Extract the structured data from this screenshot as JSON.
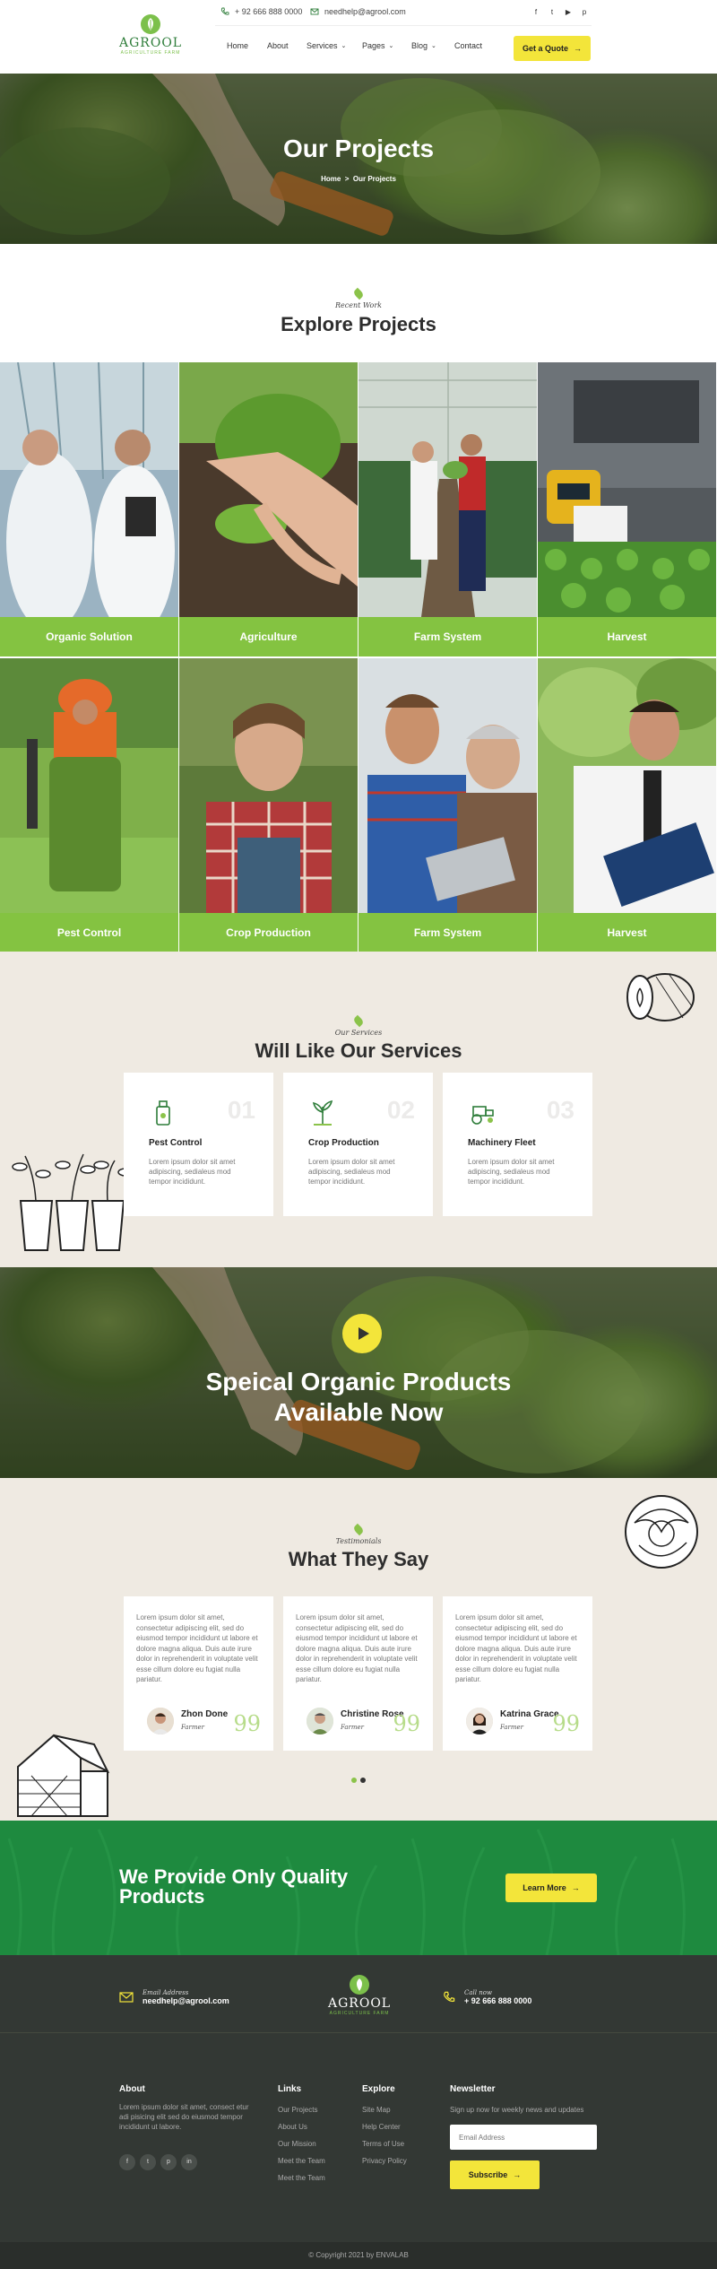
{
  "topbar": {
    "phone": "+ 92 666 888 0000",
    "email": "needhelp@agrool.com",
    "socials": [
      "facebook-icon",
      "twitter-icon",
      "youtube-icon",
      "pinterest-icon"
    ]
  },
  "brand": {
    "name": "AGROOL",
    "tagline": "AGRICULTURE FARM"
  },
  "nav": {
    "items": [
      {
        "label": "Home",
        "dropdown": false
      },
      {
        "label": "About",
        "dropdown": false
      },
      {
        "label": "Services",
        "dropdown": true
      },
      {
        "label": "Pages",
        "dropdown": true
      },
      {
        "label": "Blog",
        "dropdown": true
      },
      {
        "label": "Contact",
        "dropdown": false
      }
    ],
    "quote_button": "Get a Quote"
  },
  "hero": {
    "title": "Our Projects",
    "breadcrumb_home": "Home",
    "breadcrumb_sep": ">",
    "breadcrumb_current": "Our Projects"
  },
  "explore": {
    "subtitle": "Recent Work",
    "title": "Explore Projects",
    "projects": [
      {
        "label": "Organic Solution"
      },
      {
        "label": "Agriculture"
      },
      {
        "label": "Farm System"
      },
      {
        "label": "Harvest"
      },
      {
        "label": "Pest Control"
      },
      {
        "label": "Crop Production"
      },
      {
        "label": "Farm System"
      },
      {
        "label": "Harvest"
      }
    ]
  },
  "services": {
    "subtitle": "Our Services",
    "title": "Will Like Our Services",
    "cards": [
      {
        "num": "01",
        "title": "Pest Control",
        "text": "Lorem ipsum dolor sit amet adipiscing, sedialeus mod tempor incididunt."
      },
      {
        "num": "02",
        "title": "Crop Production",
        "text": "Lorem ipsum dolor sit amet adipiscing, sedialeus mod tempor incididunt."
      },
      {
        "num": "03",
        "title": "Machinery Fleet",
        "text": "Lorem ipsum dolor sit amet adipiscing, sedialeus mod tempor incididunt."
      }
    ]
  },
  "video": {
    "line1": "Speical Organic Products",
    "line2": "Available Now"
  },
  "testimonials": {
    "subtitle": "Testimonials",
    "title": "What They Say",
    "items": [
      {
        "text": "Lorem ipsum dolor sit amet, consectetur adipiscing elit, sed do eiusmod tempor incididunt ut labore et dolore magna aliqua. Duis aute irure dolor in reprehenderit in voluptate velit esse cillum dolore eu fugiat nulla pariatur.",
        "name": "Zhon Done",
        "role": "Farmer"
      },
      {
        "text": "Lorem ipsum dolor sit amet, consectetur adipiscing elit, sed do eiusmod tempor incididunt ut labore et dolore magna aliqua. Duis aute irure dolor in reprehenderit in voluptate velit esse cillum dolore eu fugiat nulla pariatur.",
        "name": "Christine Rose",
        "role": "Farmer"
      },
      {
        "text": "Lorem ipsum dolor sit amet, consectetur adipiscing elit, sed do eiusmod tempor incididunt ut labore et dolore magna aliqua. Duis aute irure dolor in reprehenderit in voluptate velit esse cillum dolore eu fugiat nulla pariatur.",
        "name": "Katrina Grace",
        "role": "Farmer"
      }
    ]
  },
  "cta": {
    "title": "We Provide Only Quality Products",
    "button": "Learn More"
  },
  "footer": {
    "email_label": "Email Address",
    "email": "needhelp@agrool.com",
    "call_label": "Call now",
    "phone": "+ 92 666 888 0000",
    "about_head": "About",
    "about_text": "Lorem ipsum dolor sit amet, consect etur adi pisicing elit sed do eiusmod tempor incididunt ut labore.",
    "links_head": "Links",
    "links": [
      "Our Projects",
      "About Us",
      "Our Mission",
      "Meet the Team",
      "Meet the Team"
    ],
    "explore_head": "Explore",
    "explore": [
      "Site Map",
      "Help Center",
      "Terms of Use",
      "Privacy Policy"
    ],
    "news_head": "Newsletter",
    "news_text": "Sign up now for weekly news and updates",
    "email_placeholder": "Email Address",
    "subscribe": "Subscribe",
    "socials": [
      "f",
      "t",
      "p",
      "in"
    ],
    "copyright": "© Copyright 2021 by ENVALAB"
  },
  "colors": {
    "accent_green": "#84c341",
    "dark_green": "#1e8a3f",
    "yellow": "#f3e53a",
    "beige": "#efeae2",
    "footer": "#333834"
  }
}
